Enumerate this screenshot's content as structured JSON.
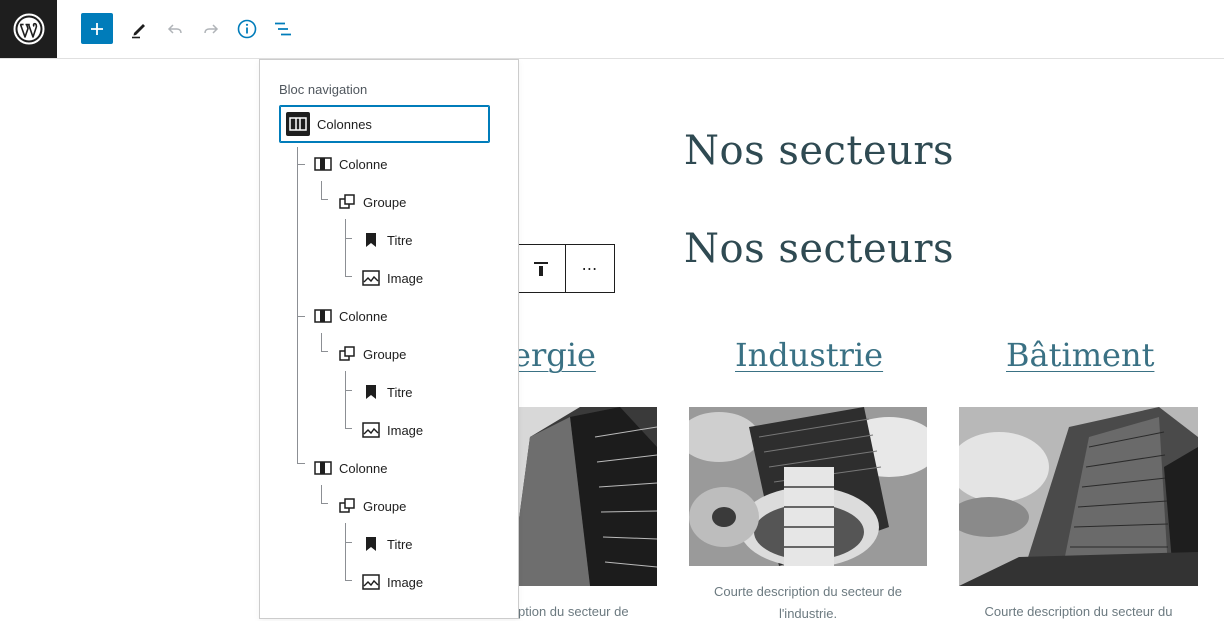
{
  "toolbar": {
    "icons": [
      "wordpress-logo",
      "plus-icon",
      "pen-icon",
      "undo-icon",
      "redo-icon",
      "info-icon",
      "list-view-icon"
    ],
    "accent_color": "#007cba"
  },
  "content": {
    "heading_1": "Nos secteurs",
    "heading_2": "Nos secteurs",
    "sectors": [
      {
        "title": "ergie",
        "description": "ption du secteur de"
      },
      {
        "title": "Industrie",
        "description": "Courte description du secteur de l'industrie."
      },
      {
        "title": "Bâtiment",
        "description": "Courte description du secteur du"
      }
    ]
  },
  "block_toolbar": {
    "icons": [
      "align-top-icon",
      "more-options-icon"
    ],
    "more_label": "⋯"
  },
  "navigation": {
    "title": "Bloc navigation",
    "root": {
      "label": "Colonnes",
      "icon": "columns-icon"
    },
    "columns": [
      {
        "label": "Colonne",
        "group": "Groupe",
        "title": "Titre",
        "image": "Image"
      },
      {
        "label": "Colonne",
        "group": "Groupe",
        "title": "Titre",
        "image": "Image"
      },
      {
        "label": "Colonne",
        "group": "Groupe",
        "title": "Titre",
        "image": "Image"
      }
    ]
  }
}
